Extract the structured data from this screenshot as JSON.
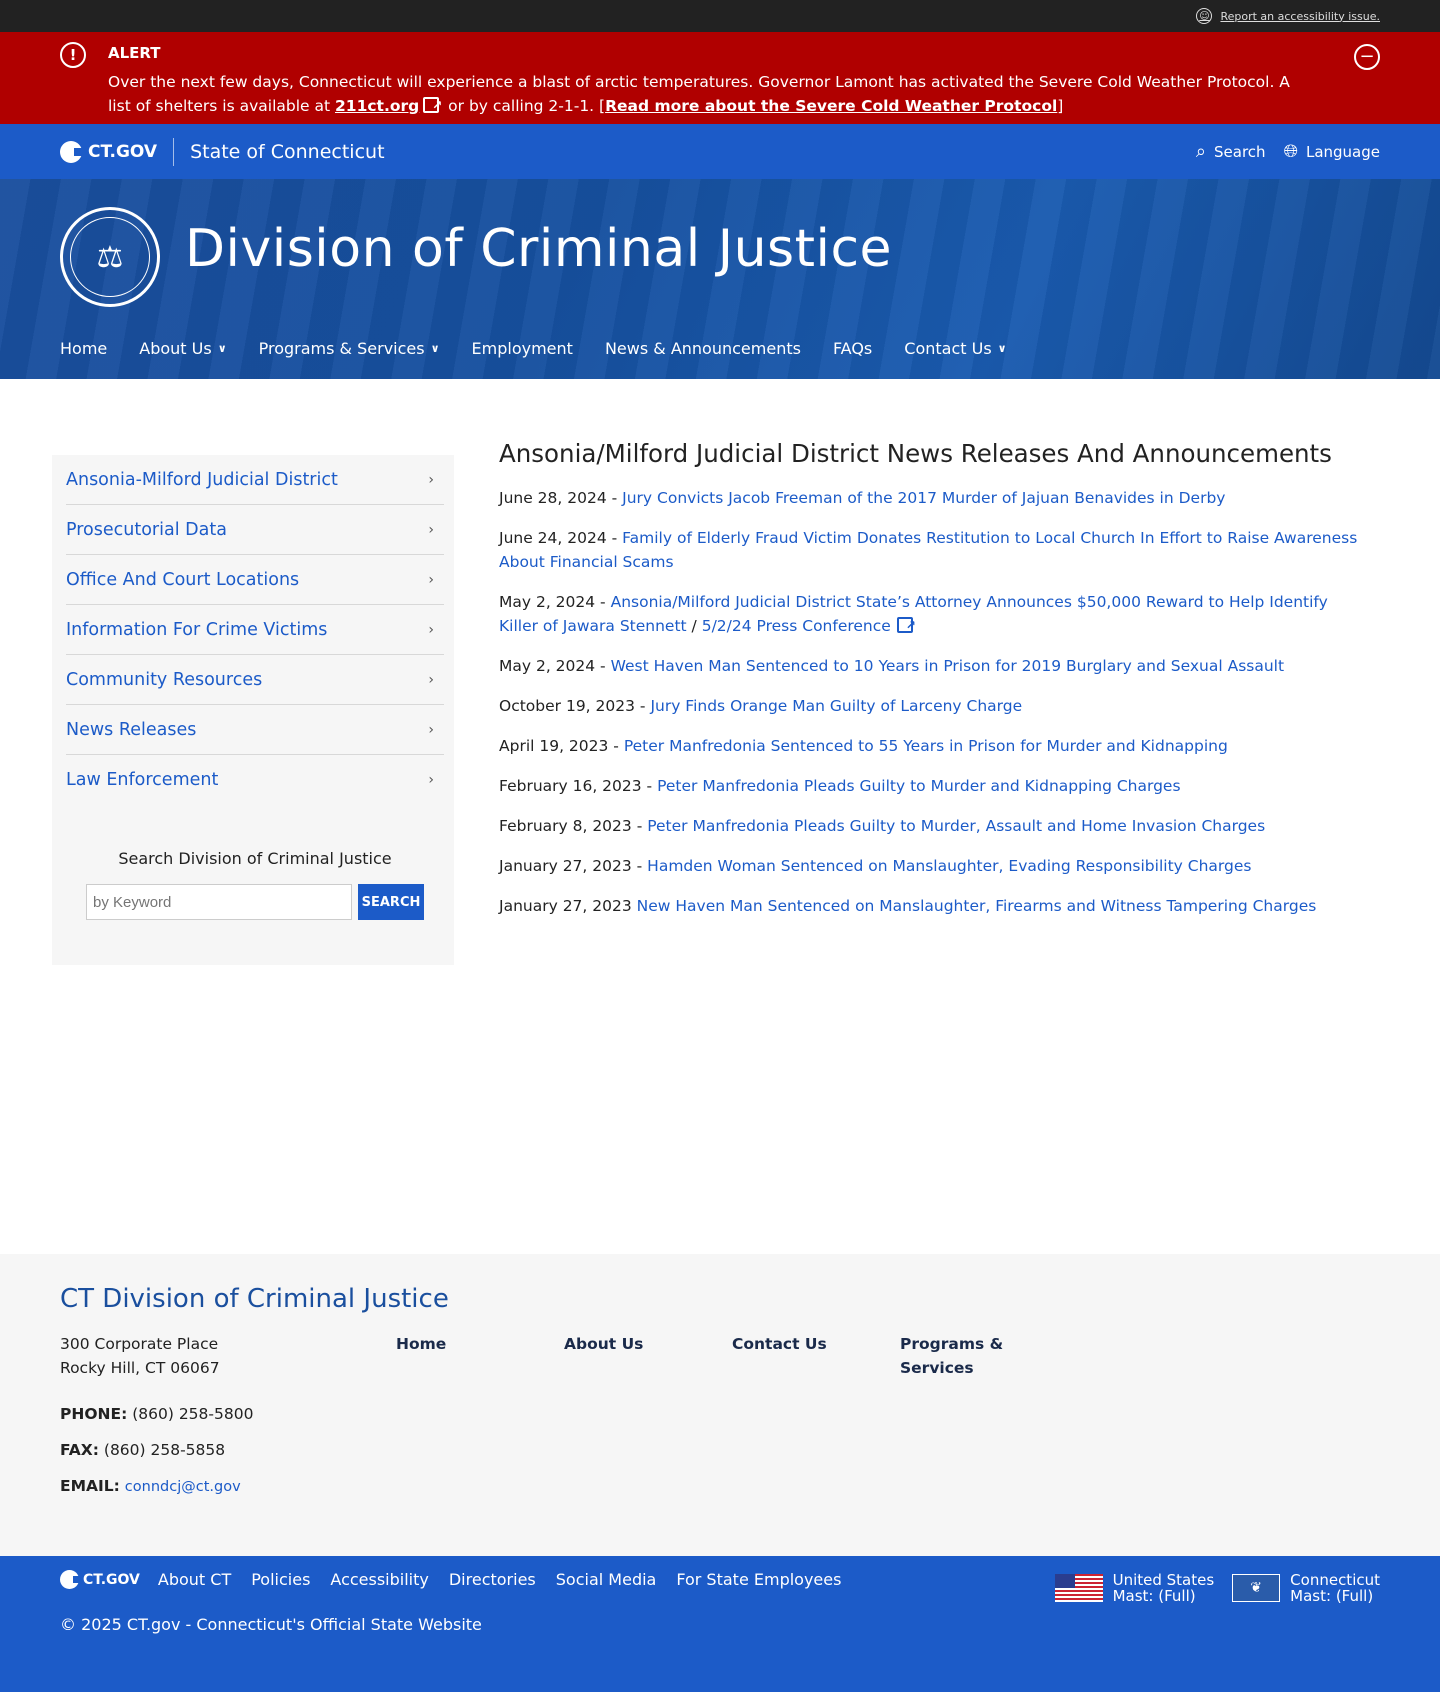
{
  "topbar": {
    "accessibility_link": "Report an accessibility issue."
  },
  "alert": {
    "title": "ALERT",
    "text_before": "Over the next few days, Connecticut will experience a blast of arctic temperatures. Governor Lamont has activated the Severe Cold Weather Protocol. A list of shelters is available at ",
    "link1": "211ct.org",
    "text_middle": " or by calling 2-1-1. [",
    "link2": "Read more about the Severe Cold Weather Protocol",
    "text_after": "]"
  },
  "ctbar": {
    "logo": "CT.GOV",
    "state": "State of Connecticut",
    "search": "Search",
    "language": "Language"
  },
  "hero": {
    "title": "Division of Criminal Justice",
    "nav": [
      "Home",
      "About Us",
      "Programs & Services",
      "Employment",
      "News & Announcements",
      "FAQs",
      "Contact Us"
    ]
  },
  "sidebar": {
    "items": [
      "Ansonia-Milford Judicial District",
      "Prosecutorial Data",
      "Office And Court Locations",
      "Information For Crime Victims",
      "Community Resources",
      "News Releases",
      "Law Enforcement"
    ],
    "search_title": "Search Division of Criminal Justice",
    "search_placeholder": "by Keyword",
    "search_button": "SEARCH"
  },
  "content": {
    "heading": "Ansonia/Milford Judicial District News Releases And Announcements",
    "news": [
      {
        "date": "June 28, 2024 - ",
        "title": "Jury Convicts Jacob Freeman of the 2017 Murder of Jajuan Benavides in Derby"
      },
      {
        "date": "June 24, 2024 - ",
        "title": "Family of Elderly Fraud Victim Donates Restitution to Local Church In Effort to Raise Awareness About Financial Scams"
      },
      {
        "date": "May 2, 2024 - ",
        "title": "Ansonia/Milford Judicial District State’s Attorney Announces $50,000 Reward to Help Identify Killer of Jawara Stennett",
        "sep": " / ",
        "extra": "5/2/24 Press Conference"
      },
      {
        "date": "May 2, 2024 - ",
        "title": "West Haven Man Sentenced to 10 Years in Prison for 2019 Burglary and Sexual Assault"
      },
      {
        "date": "October 19, 2023 - ",
        "title": "Jury Finds Orange Man Guilty of Larceny Charge"
      },
      {
        "date": "April 19, 2023 - ",
        "title": "Peter Manfredonia Sentenced to 55 Years in Prison for Murder and Kidnapping"
      },
      {
        "date": "February 16, 2023 - ",
        "title": "Peter Manfredonia Pleads Guilty to Murder and Kidnapping Charges"
      },
      {
        "date": "February 8, 2023 - ",
        "title": "Peter Manfredonia Pleads Guilty to Murder, Assault and Home Invasion Charges"
      },
      {
        "date": "January 27, 2023 - ",
        "title": "Hamden Woman Sentenced on Manslaughter, Evading Responsibility Charges"
      },
      {
        "date": "January 27, 2023 ",
        "title": "New Haven Man Sentenced on Manslaughter, Firearms and Witness Tampering Charges"
      }
    ]
  },
  "footer": {
    "title": "CT Division of Criminal Justice",
    "address_line1": "300 Corporate Place",
    "address_line2": "Rocky Hill, CT 06067",
    "phone_label": "PHONE:",
    "phone": " (860) 258-5800",
    "fax_label": "FAX:",
    "fax": " (860) 258-5858",
    "email_label": "EMAIL:",
    "email": "conndcj@ct.gov",
    "links": [
      "Home",
      "About Us",
      "Contact Us",
      "Programs & Services"
    ]
  },
  "bottombar": {
    "logo": "CT.GOV",
    "links": [
      "About CT",
      "Policies",
      "Accessibility",
      "Directories",
      "Social Media",
      "For State Employees"
    ],
    "mast_us_line1": "United States",
    "mast_us_line2": "Mast: (Full)",
    "mast_ct_line1": "Connecticut",
    "mast_ct_line2": "Mast: (Full)",
    "copyright": "© 2025 CT.gov - Connecticut's Official State Website"
  }
}
